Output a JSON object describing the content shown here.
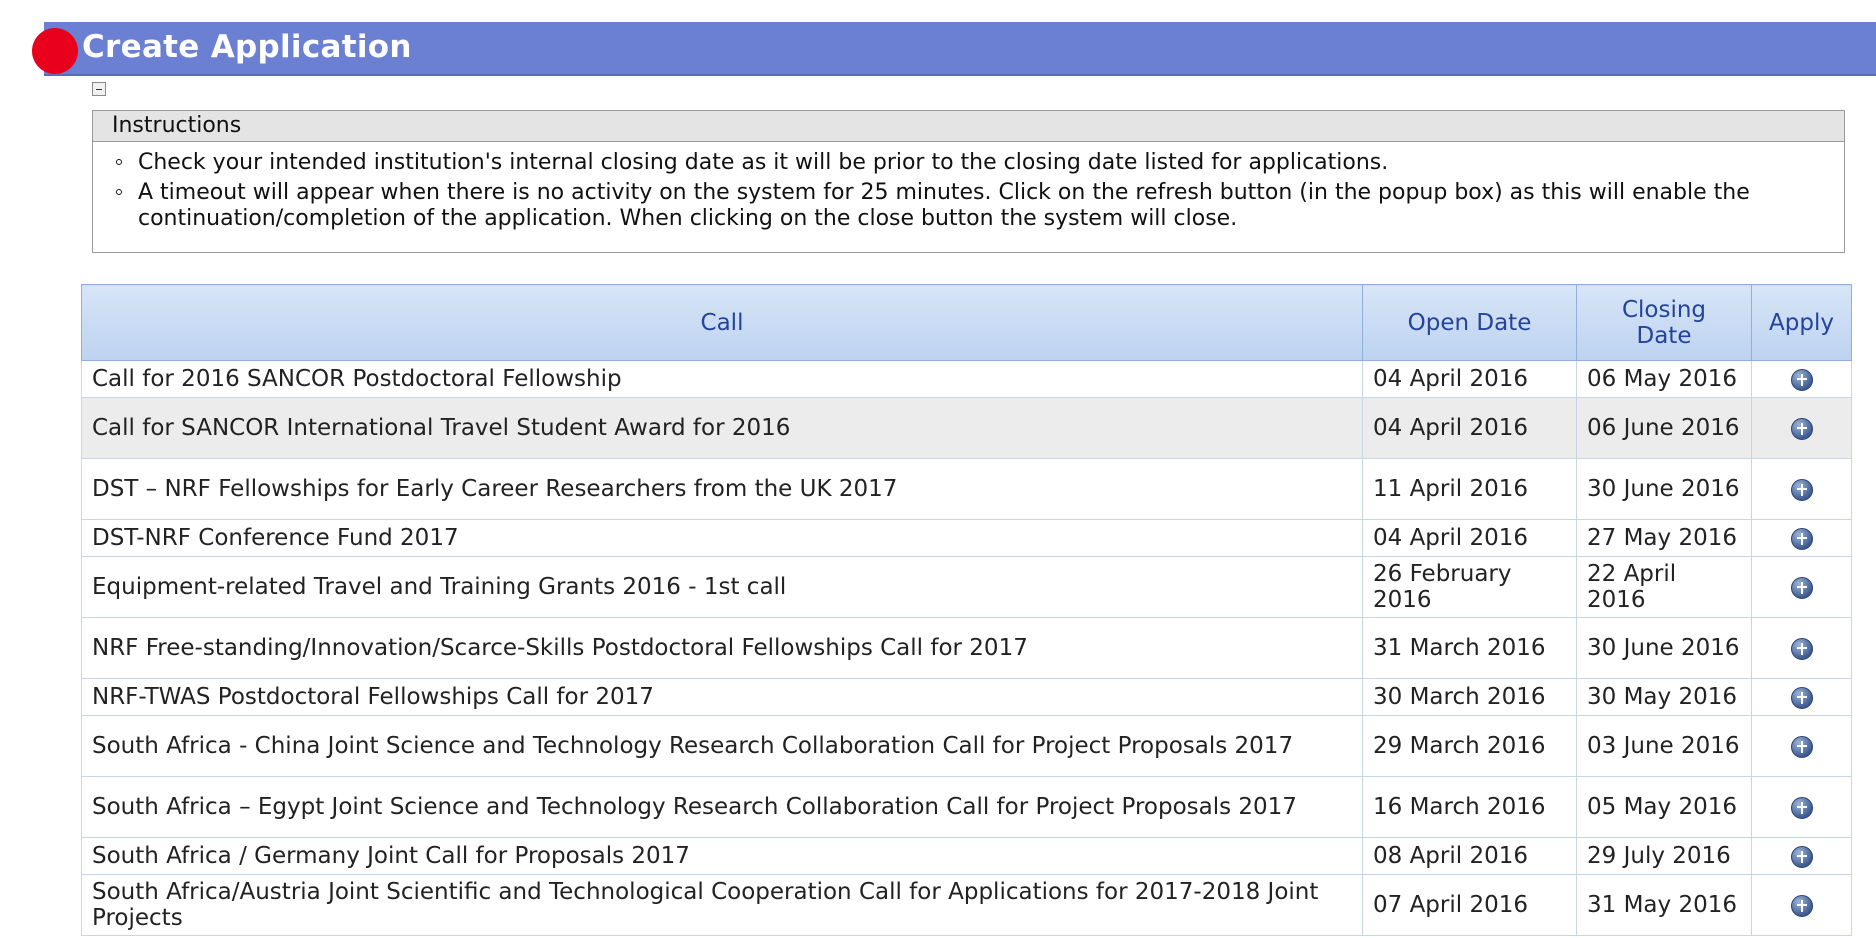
{
  "header": {
    "title": "Create Application"
  },
  "instructions": {
    "heading": "Instructions",
    "items": [
      "Check your intended institution's internal closing date as it will be prior to the closing date listed for applications.",
      "A timeout will appear when there is no activity on the system for 25 minutes. Click on the refresh button (in the popup box) as this will enable the continuation/completion of the application. When clicking on the close button the system will close."
    ]
  },
  "table": {
    "columns": {
      "call": "Call",
      "open": "Open Date",
      "close": "Closing Date",
      "apply": "Apply"
    },
    "rows": [
      {
        "call": "Call for 2016 SANCOR Postdoctoral Fellowship",
        "open": "04 April 2016",
        "close": "06 May 2016"
      },
      {
        "call": "Call for SANCOR International Travel Student Award for 2016",
        "open": "04 April 2016",
        "close": "06 June 2016"
      },
      {
        "call": "DST – NRF Fellowships for Early Career Researchers from the UK 2017",
        "open": "11 April 2016",
        "close": "30 June 2016"
      },
      {
        "call": "DST-NRF Conference Fund 2017",
        "open": "04 April 2016",
        "close": "27 May 2016"
      },
      {
        "call": "Equipment-related Travel and Training Grants 2016 - 1st call",
        "open": "26 February 2016",
        "close": "22 April 2016"
      },
      {
        "call": "NRF Free-standing/Innovation/Scarce-Skills Postdoctoral Fellowships Call for 2017",
        "open": "31 March 2016",
        "close": "30 June 2016"
      },
      {
        "call": "NRF-TWAS Postdoctoral Fellowships Call for 2017",
        "open": "30 March 2016",
        "close": "30 May 2016"
      },
      {
        "call": "South Africa - China Joint Science and Technology Research Collaboration Call for Project Proposals 2017",
        "open": "29 March 2016",
        "close": "03 June 2016"
      },
      {
        "call": "South Africa – Egypt Joint Science and Technology Research Collaboration Call for Project Proposals 2017",
        "open": "16 March 2016",
        "close": "05 May 2016"
      },
      {
        "call": "South Africa / Germany Joint Call for Proposals 2017",
        "open": "08 April 2016",
        "close": "29 July 2016"
      },
      {
        "call": "South Africa/Austria Joint Scientific and Technological Cooperation Call for Applications for 2017-2018 Joint Projects",
        "open": "07 April 2016",
        "close": "31 May 2016"
      }
    ]
  },
  "icons": {
    "apply": "add-circle-icon",
    "collapse": "minus-box-icon"
  },
  "colors": {
    "header_bg": "#6b7fd3",
    "header_dot": "#e8001c",
    "table_header_text": "#24439a"
  }
}
